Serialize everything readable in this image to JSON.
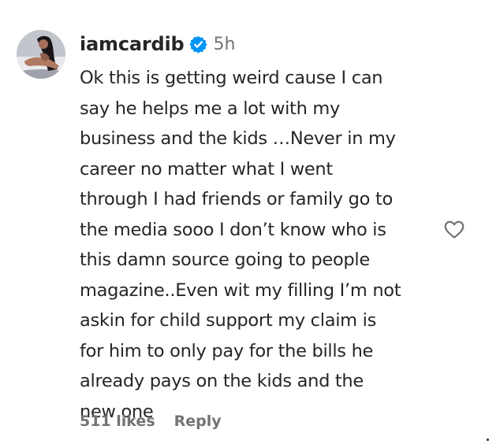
{
  "comment": {
    "username": "iamcardib",
    "verified": true,
    "time": "5h",
    "text": "Ok this is getting weird cause I can\nsay he helps me a lot with my\nbusiness and the kids …Never in my\ncareer no matter what I went\nthrough I had friends or family go to\nthe media sooo I don’t know who is\nthis damn source going to people\nmagazine..Even wit my filling I’m not\naskin for child support my claim is\nfor him to only pay for the bills he\nalready pays on the kids and the\nnew one",
    "likes": "511 likes",
    "reply": "Reply"
  },
  "icons": {
    "avatar": "avatar",
    "verified": "verified-badge-icon",
    "like": "heart-outline-icon"
  },
  "colors": {
    "text": "#262626",
    "muted": "#737373",
    "verified": "#0095f6"
  }
}
